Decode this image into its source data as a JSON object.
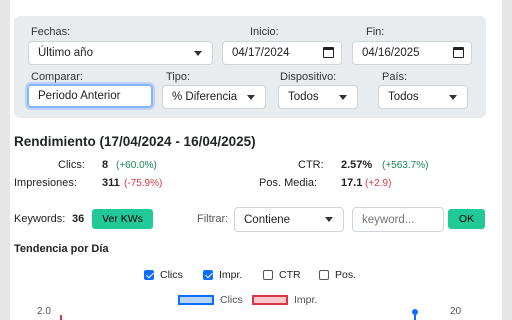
{
  "filters": {
    "fechas": {
      "label": "Fechas:",
      "value": "Último año"
    },
    "inicio": {
      "label": "Inicio:",
      "value": "04/17/2024"
    },
    "fin": {
      "label": "Fin:",
      "value": "04/16/2025"
    },
    "comparar": {
      "label": "Comparar:",
      "value": "Periodo Anterior"
    },
    "tipo": {
      "label": "Tipo:",
      "value": "% Diferencia"
    },
    "dispositivo": {
      "label": "Dispositivo:",
      "value": "Todos"
    },
    "pais": {
      "label": "País:",
      "value": "Todos"
    }
  },
  "rendimiento": {
    "title": "Rendimiento (17/04/2024 - 16/04/2025)",
    "clics": {
      "label": "Clics:",
      "value": "8",
      "delta": "(+60.0%)"
    },
    "impresiones": {
      "label": "Impresiones:",
      "value": "311",
      "delta": "(-75.9%)"
    },
    "ctr": {
      "label": "CTR:",
      "value": "2.57%",
      "delta": "(+563.7%)"
    },
    "posmedia": {
      "label": "Pos. Media:",
      "value": "17.1",
      "delta": "(+2.9)"
    }
  },
  "keywords": {
    "label": "Keywords:",
    "count": "36",
    "ver_button": "Ver KWs",
    "filtrar_label": "Filtrar:",
    "filter_mode": "Contiene",
    "placeholder": "keyword...",
    "ok_button": "OK"
  },
  "tendencia": {
    "title": "Tendencia por Día",
    "toggles": [
      {
        "label": "Clics",
        "checked": true
      },
      {
        "label": "Impr.",
        "checked": true
      },
      {
        "label": "CTR",
        "checked": false
      },
      {
        "label": "Pos.",
        "checked": false
      }
    ],
    "legend": [
      {
        "label": "Clics",
        "color": "#0d6efd",
        "fill": "#b8d4f5"
      },
      {
        "label": "Impr.",
        "color": "#dc3545",
        "fill": "#f5c8cc"
      }
    ],
    "y_left_top": "2.0",
    "y_right_top": "20"
  },
  "colors": {
    "accent": "#0d6efd",
    "success": "#20c997",
    "positive": "#198754",
    "negative": "#dc3545"
  }
}
